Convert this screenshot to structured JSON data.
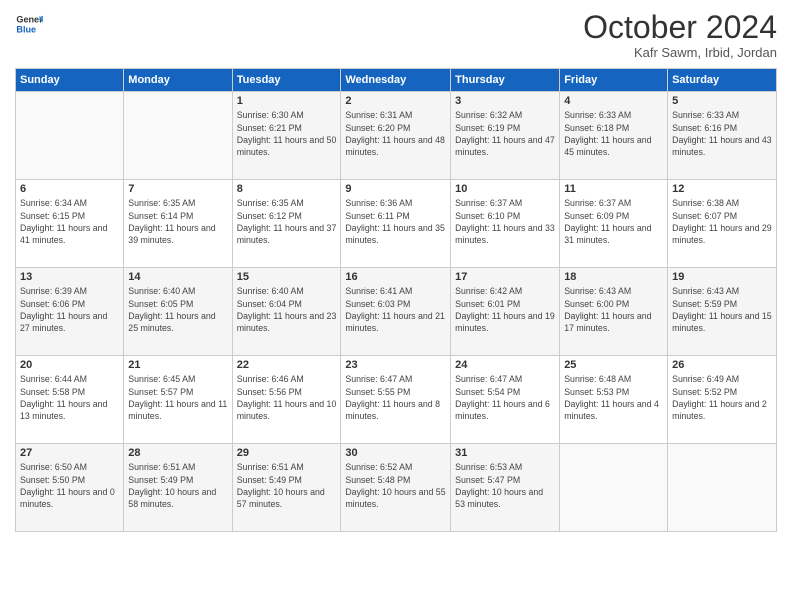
{
  "header": {
    "logo_general": "General",
    "logo_blue": "Blue",
    "month_title": "October 2024",
    "location": "Kafr Sawm, Irbid, Jordan"
  },
  "days_of_week": [
    "Sunday",
    "Monday",
    "Tuesday",
    "Wednesday",
    "Thursday",
    "Friday",
    "Saturday"
  ],
  "weeks": [
    [
      {
        "day": "",
        "info": ""
      },
      {
        "day": "",
        "info": ""
      },
      {
        "day": "1",
        "sunrise": "6:30 AM",
        "sunset": "6:21 PM",
        "daylight": "11 hours and 50 minutes."
      },
      {
        "day": "2",
        "sunrise": "6:31 AM",
        "sunset": "6:20 PM",
        "daylight": "11 hours and 48 minutes."
      },
      {
        "day": "3",
        "sunrise": "6:32 AM",
        "sunset": "6:19 PM",
        "daylight": "11 hours and 47 minutes."
      },
      {
        "day": "4",
        "sunrise": "6:33 AM",
        "sunset": "6:18 PM",
        "daylight": "11 hours and 45 minutes."
      },
      {
        "day": "5",
        "sunrise": "6:33 AM",
        "sunset": "6:16 PM",
        "daylight": "11 hours and 43 minutes."
      }
    ],
    [
      {
        "day": "6",
        "sunrise": "6:34 AM",
        "sunset": "6:15 PM",
        "daylight": "11 hours and 41 minutes."
      },
      {
        "day": "7",
        "sunrise": "6:35 AM",
        "sunset": "6:14 PM",
        "daylight": "11 hours and 39 minutes."
      },
      {
        "day": "8",
        "sunrise": "6:35 AM",
        "sunset": "6:12 PM",
        "daylight": "11 hours and 37 minutes."
      },
      {
        "day": "9",
        "sunrise": "6:36 AM",
        "sunset": "6:11 PM",
        "daylight": "11 hours and 35 minutes."
      },
      {
        "day": "10",
        "sunrise": "6:37 AM",
        "sunset": "6:10 PM",
        "daylight": "11 hours and 33 minutes."
      },
      {
        "day": "11",
        "sunrise": "6:37 AM",
        "sunset": "6:09 PM",
        "daylight": "11 hours and 31 minutes."
      },
      {
        "day": "12",
        "sunrise": "6:38 AM",
        "sunset": "6:07 PM",
        "daylight": "11 hours and 29 minutes."
      }
    ],
    [
      {
        "day": "13",
        "sunrise": "6:39 AM",
        "sunset": "6:06 PM",
        "daylight": "11 hours and 27 minutes."
      },
      {
        "day": "14",
        "sunrise": "6:40 AM",
        "sunset": "6:05 PM",
        "daylight": "11 hours and 25 minutes."
      },
      {
        "day": "15",
        "sunrise": "6:40 AM",
        "sunset": "6:04 PM",
        "daylight": "11 hours and 23 minutes."
      },
      {
        "day": "16",
        "sunrise": "6:41 AM",
        "sunset": "6:03 PM",
        "daylight": "11 hours and 21 minutes."
      },
      {
        "day": "17",
        "sunrise": "6:42 AM",
        "sunset": "6:01 PM",
        "daylight": "11 hours and 19 minutes."
      },
      {
        "day": "18",
        "sunrise": "6:43 AM",
        "sunset": "6:00 PM",
        "daylight": "11 hours and 17 minutes."
      },
      {
        "day": "19",
        "sunrise": "6:43 AM",
        "sunset": "5:59 PM",
        "daylight": "11 hours and 15 minutes."
      }
    ],
    [
      {
        "day": "20",
        "sunrise": "6:44 AM",
        "sunset": "5:58 PM",
        "daylight": "11 hours and 13 minutes."
      },
      {
        "day": "21",
        "sunrise": "6:45 AM",
        "sunset": "5:57 PM",
        "daylight": "11 hours and 11 minutes."
      },
      {
        "day": "22",
        "sunrise": "6:46 AM",
        "sunset": "5:56 PM",
        "daylight": "11 hours and 10 minutes."
      },
      {
        "day": "23",
        "sunrise": "6:47 AM",
        "sunset": "5:55 PM",
        "daylight": "11 hours and 8 minutes."
      },
      {
        "day": "24",
        "sunrise": "6:47 AM",
        "sunset": "5:54 PM",
        "daylight": "11 hours and 6 minutes."
      },
      {
        "day": "25",
        "sunrise": "6:48 AM",
        "sunset": "5:53 PM",
        "daylight": "11 hours and 4 minutes."
      },
      {
        "day": "26",
        "sunrise": "6:49 AM",
        "sunset": "5:52 PM",
        "daylight": "11 hours and 2 minutes."
      }
    ],
    [
      {
        "day": "27",
        "sunrise": "6:50 AM",
        "sunset": "5:50 PM",
        "daylight": "11 hours and 0 minutes."
      },
      {
        "day": "28",
        "sunrise": "6:51 AM",
        "sunset": "5:49 PM",
        "daylight": "10 hours and 58 minutes."
      },
      {
        "day": "29",
        "sunrise": "6:51 AM",
        "sunset": "5:49 PM",
        "daylight": "10 hours and 57 minutes."
      },
      {
        "day": "30",
        "sunrise": "6:52 AM",
        "sunset": "5:48 PM",
        "daylight": "10 hours and 55 minutes."
      },
      {
        "day": "31",
        "sunrise": "6:53 AM",
        "sunset": "5:47 PM",
        "daylight": "10 hours and 53 minutes."
      },
      {
        "day": "",
        "info": ""
      },
      {
        "day": "",
        "info": ""
      }
    ]
  ],
  "labels": {
    "sunrise": "Sunrise:",
    "sunset": "Sunset:",
    "daylight": "Daylight:"
  }
}
